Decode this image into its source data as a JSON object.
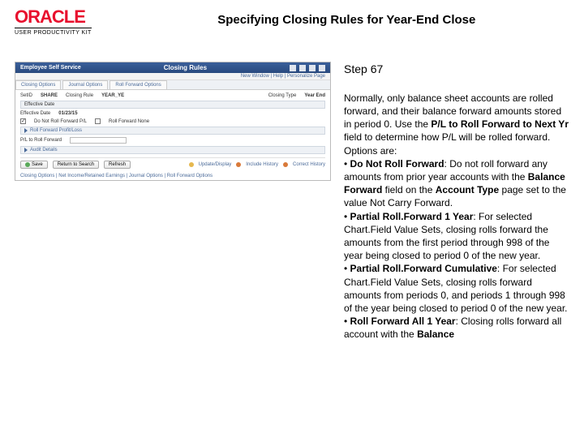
{
  "header": {
    "brand": "ORACLE",
    "brand_sub": "USER PRODUCTIVITY KIT",
    "page_title": "Specifying Closing Rules for Year-End Close"
  },
  "step": {
    "label": "Step 67"
  },
  "instruction": {
    "intro_1": "Normally, only balance sheet accounts are rolled forward, and their balance forward amounts stored in period 0. Use the ",
    "intro_bold_1": "P/L to Roll Forward to Next Yr",
    "intro_2": " field to determine how P/L will be rolled forward. Options are:",
    "b1_bold": "Do Not Roll Forward",
    "b1_1": ": Do not roll forward any amounts from prior year accounts with the ",
    "b1_bold2": "Balance Forward",
    "b1_2": " field on the ",
    "b1_bold3": "Account Type",
    "b1_3": " page set to the value Not Carry Forward.",
    "b2_bold": "Partial Roll.Forward 1 Year",
    "b2_1": ": For selected Chart.Field Value Sets, closing rolls forward the amounts from the first period through 998 of the year being closed to period 0 of the new year.",
    "b3_bold": "Partial Roll.Forward Cumulative",
    "b3_1": ": For selected Chart.Field Value Sets, closing rolls forward amounts from periods 0, and periods 1 through 998 of the year being closed to period 0 of the new year.",
    "b4_bold": "Roll Forward All 1 Year",
    "b4_1": ": Closing rolls forward all account with the ",
    "b4_bold2": "Balance"
  },
  "mock": {
    "topbar_left": "Employee Self Service",
    "topbar_mid": "Closing Rules",
    "breadcrumb": "New Window | Help | Personalize Page",
    "tab1": "Closing Options",
    "tab2": "Journal Options",
    "tab3": "Roll Forward Options",
    "setid_label": "SetID",
    "setid_val": "SHARE",
    "rule_label": "Closing Rule",
    "rule_val": "YEAR_YE",
    "eff_label": "Effective Date",
    "eff_val": "01/23/15",
    "closetype_label": "Closing Type",
    "closetype_val": "Year End",
    "chk1": "Do Not Roll Forward P/L",
    "chk2": "Roll Forward None",
    "sec_hdr": "Roll Forward Profit/Loss",
    "select_label": "P/L to Roll Forward",
    "select_val": "",
    "audit_label": "Audit Details",
    "btn_save": "Save",
    "btn_return": "Return to Search",
    "btn_refresh": "Refresh",
    "link_update": "Update/Display",
    "link_history": "Include History",
    "link_correct": "Correct History",
    "footer": "Closing Options | Net Income/Retained Earnings | Journal Options | Roll Forward Options"
  }
}
